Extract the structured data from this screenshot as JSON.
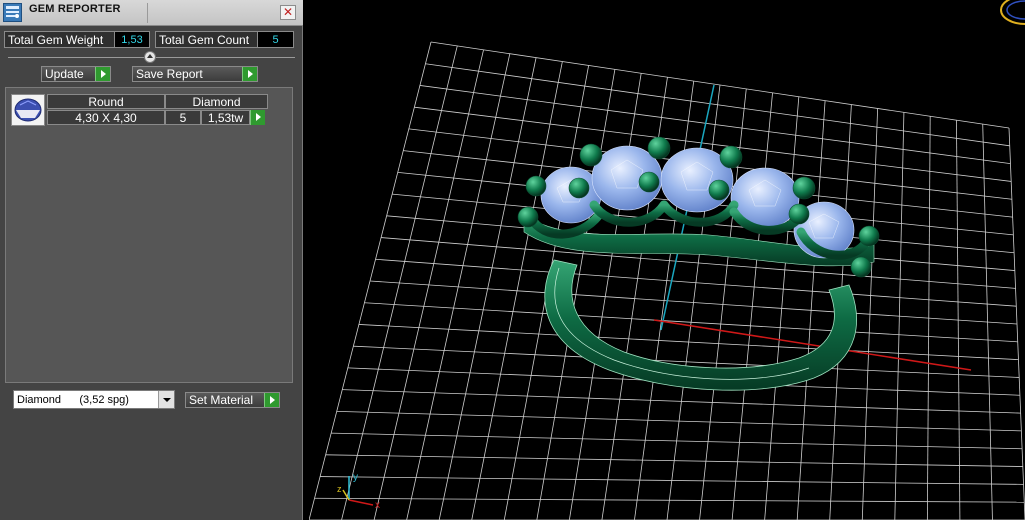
{
  "window": {
    "title": "GEM REPORTER",
    "close_symbol": "✕"
  },
  "summary": {
    "weight_label": "Total Gem Weight",
    "weight_value": "1,53",
    "count_label": "Total Gem Count",
    "count_value": "5"
  },
  "actions": {
    "update_label": "Update",
    "save_report_label": "Save Report"
  },
  "gem_table": {
    "headers": {
      "shape": "Round",
      "material": "Diamond"
    },
    "rows": [
      {
        "size": "4,30 X 4,30",
        "count": "5",
        "weight": "1,53tw"
      }
    ]
  },
  "material": {
    "selected": "Diamond      (3,52 spg)",
    "set_label": "Set Material"
  },
  "viewport": {
    "axis_labels": {
      "x": "x",
      "y": "y",
      "z": "z"
    },
    "colors": {
      "grid": "#cfcfcf",
      "metal": "#0e6b44",
      "gem": "#9ab6ec",
      "x_axis": "#d01818",
      "y_axis": "#1aa7c0"
    }
  },
  "icons": [
    "gem-reporter-app-icon",
    "close-icon",
    "collapse-arrow-icon",
    "play-arrow-icon",
    "round-gem-icon",
    "dropdown-arrow-icon",
    "axis-gizmo-icon"
  ]
}
